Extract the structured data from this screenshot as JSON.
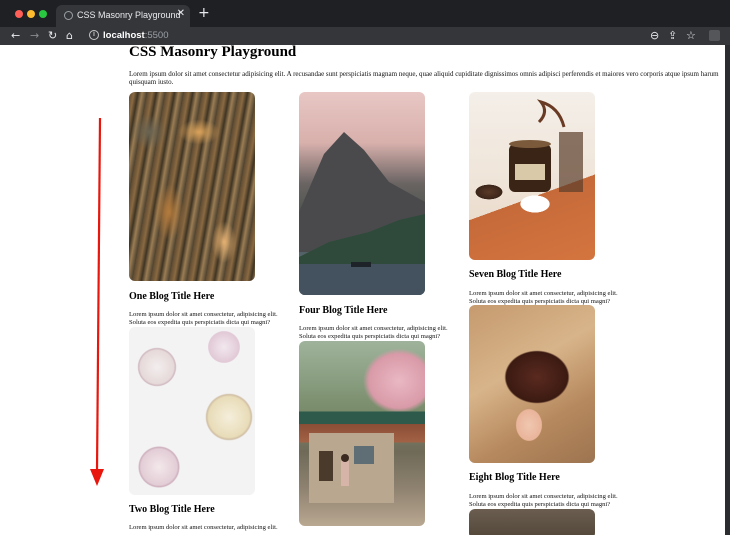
{
  "browser": {
    "tab_title": "CSS Masonry Playground",
    "tab_close": "✕",
    "new_tab": "+",
    "url_host": "localhost",
    "url_port": ":5500",
    "icons": [
      "back-icon",
      "forward-icon",
      "reload-icon",
      "home-icon",
      "info-icon",
      "zoom-icon",
      "share-icon",
      "star-icon",
      "extension-icon"
    ],
    "nav": {
      "back": "←",
      "forward": "→",
      "reload": "↻",
      "home": "⌂",
      "info": "i",
      "zoom": "⊖",
      "share": "⇪",
      "star": "☆"
    }
  },
  "page": {
    "title": "CSS Masonry Playground",
    "intro": "Lorem ipsum dolor sit amet consectetur adipisicing elit. A recusandae sunt perspiciatis magnam neque, quae aliquid cupiditate dignissimos omnis adipisci perferendis et maiores vero corporis atque ipsum harum quisquam iusto."
  },
  "cards": [
    {
      "title": "One Blog Title Here",
      "text": "Lorem ipsum dolor sit amet consectetur, adipisicing elit. Soluta eos expedita quis perspiciatis dicta qui magni?"
    },
    {
      "title": "Two Blog Title Here",
      "text": "Lorem ipsum dolor sit amet consectetur, adipisicing elit."
    },
    {
      "title": "Four Blog Title Here",
      "text": "Lorem ipsum dolor sit amet consectetur, adipisicing elit. Soluta eos expedita quis perspiciatis dicta qui magni?"
    },
    {
      "title": "Seven Blog Title Here",
      "text": "Lorem ipsum dolor sit amet consectetur, adipisicing elit. Soluta eos expedita quis perspiciatis dicta qui magni?"
    },
    {
      "title": "Eight Blog Title Here",
      "text": "Lorem ipsum dolor sit amet consectetur, adipisicing elit. Soluta eos expedita quis perspiciatis dicta qui magni?"
    }
  ],
  "annotation": {
    "arrow_color": "#e8160c",
    "direction": "down"
  },
  "colors": {
    "tabbar": "#1f2023",
    "toolbar": "#35363a",
    "accent_red": "#ff5f57",
    "accent_yellow": "#febc2e",
    "accent_green": "#28c840"
  }
}
